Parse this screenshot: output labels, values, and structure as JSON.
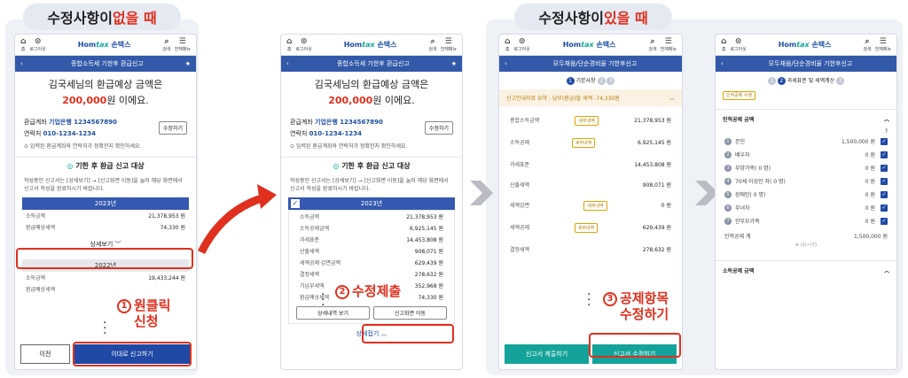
{
  "labels": {
    "left": {
      "prefix": "수정사항이 ",
      "red": "없을 때"
    },
    "right": {
      "prefix": "수정사항이 ",
      "red": "있을 때"
    }
  },
  "common": {
    "home_label": "홈",
    "login_label": "로그아웃",
    "search_label": "검색",
    "menu_label": "전체메뉴",
    "logo_main": "Hom",
    "logo_tax": "tax",
    "logo_brand": "손택스"
  },
  "screen1": {
    "nav_title": "종합소득세 기한후 환급신고",
    "greeting_line1": "김국세님의 환급예상 금액은",
    "amount": "200,000",
    "amount_suffix": "원 이에요.",
    "account_label": "환급계좌",
    "account_value": "기업은행 1234567890",
    "contact_label": "연락처",
    "contact_value": "010-1234-1234",
    "edit_button": "수정하기",
    "check_note": "입력된 환급계좌와 연락처가 정확한지 확인하세요.",
    "section_title": "기한 후 환급 신고 대상",
    "guide": "작성중인 신고서는 [상세보기] → [신고화면 이동]을 눌러 해당 화면에서 신고서 작성을 완료하시기 바랍니다.",
    "year1": "2023년",
    "y1_rows": [
      {
        "k": "소득금액",
        "v": "21,378,953 원"
      },
      {
        "k": "환급예상세액",
        "v": "74,330 원"
      }
    ],
    "detail_button": "상세보기",
    "year2": "2022년",
    "y2_rows": [
      {
        "k": "소득금액",
        "v": "19,433,244 원"
      },
      {
        "k": "환급예상세액",
        "v": ""
      }
    ],
    "prev_button": "이전",
    "submit_button": "이대로 신고하기",
    "callout": "원클릭\n신청",
    "callout_num": "1"
  },
  "screen2": {
    "nav_title": "종합소득세 기한후 환급신고",
    "year": "2023년",
    "rows": [
      {
        "k": "소득금액",
        "v": "21,378,953 원"
      },
      {
        "k": "소득공제금액",
        "v": "6,925,145 원"
      },
      {
        "k": "과세표준",
        "v": "14,453,808 원"
      },
      {
        "k": "산출세액",
        "v": "908,071 원"
      },
      {
        "k": "세액공제·감면금액",
        "v": "629,439 원"
      },
      {
        "k": "결정세액",
        "v": "278,632 원"
      },
      {
        "k": "기납부세액",
        "v": "352,968 원"
      },
      {
        "k": "환급예상세액",
        "v": "74,330 원"
      }
    ],
    "detail_btn": "상세내역 보기",
    "move_btn": "신고화면 이동",
    "fold": "상세접기",
    "callout": "수정제출",
    "callout_num": "2"
  },
  "screen3": {
    "nav_title": "모두채움/단순경비율 기한후신고",
    "step_label": "기본사항",
    "summary": "신고안내자료 요약 : 납부(환급)할 세액 -74,330원",
    "rows": [
      {
        "k": "종합소득금액",
        "chip": "세부내역",
        "v": "21,378,953 원"
      },
      {
        "k": "소득공제",
        "chip": "세부내역",
        "v": "6,925,145 원"
      },
      {
        "k": "과세표준",
        "chip": "",
        "v": "14,453,808 원"
      },
      {
        "k": "산출세액",
        "chip": "",
        "v": "908,071 원"
      },
      {
        "k": "세액감면",
        "chip": "세부내역",
        "v": "0 원"
      },
      {
        "k": "세액공제",
        "chip": "세부내역",
        "v": "629,439 원"
      },
      {
        "k": "결정세액",
        "chip": "",
        "v": "278,632 원"
      }
    ],
    "submit_btn": "신고서 제출하기",
    "edit_btn": "신고서 수정하기",
    "callout": "공제항목\n수정하기",
    "callout_num": "3"
  },
  "screen4": {
    "nav_title": "모두채움/단순경비율 기한후신고",
    "step_label": "과세표준 및 세액계산",
    "edit_chip": "인적공제 수정",
    "section": "인적공제 금액",
    "rows": [
      {
        "n": "1",
        "k": "본인",
        "v": "1,500,000 원"
      },
      {
        "n": "2",
        "k": "배우자",
        "v": "0 원"
      },
      {
        "n": "3",
        "k": "부양가족( 0 명)",
        "v": "0 원"
      },
      {
        "n": "4",
        "k": "70세 이상인 자( 0 명)",
        "v": "0 원"
      },
      {
        "n": "5",
        "k": "장애인( 0 명)",
        "v": "0 원"
      },
      {
        "n": "6",
        "k": "부녀자",
        "v": "0 원"
      },
      {
        "n": "7",
        "k": "한부모가족",
        "v": "0 원"
      }
    ],
    "total_label": "인적공제 계",
    "total_value": "1,500,000 원",
    "total_note": "※ (1)~(7)",
    "section2": "소득공제 금액"
  }
}
